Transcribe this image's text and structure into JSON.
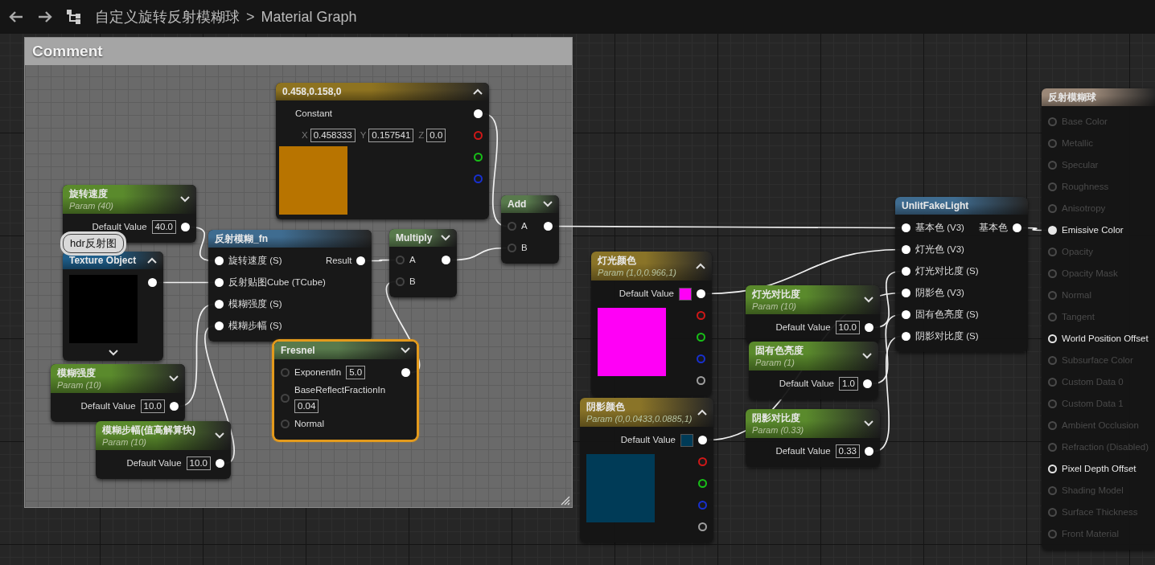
{
  "toolbar": {
    "breadcrumb": [
      {
        "label": "自定义旋转反射模糊球"
      },
      {
        "label": "Material Graph"
      }
    ],
    "separator": ">"
  },
  "comment": {
    "title": "Comment"
  },
  "tooltip": {
    "text": "hdr反射图"
  },
  "nodes": [
    {
      "kind": "constant",
      "title": "0.458,0.158,0",
      "expanded": true,
      "selected": false,
      "label": "Constant",
      "fields": [
        {
          "axis": "X",
          "value": "0.458333"
        },
        {
          "axis": "Y",
          "value": "0.157541"
        },
        {
          "axis": "Z",
          "value": "0.0"
        }
      ],
      "preview": {
        "color": "#b87400"
      },
      "pins": [
        {
          "color": "#ffffff",
          "filled": true
        },
        {
          "color": "#d01818",
          "filled": false
        },
        {
          "color": "#18c018",
          "filled": false
        },
        {
          "color": "#1830d0",
          "filled": false
        }
      ]
    },
    {
      "kind": "scalar_param",
      "title": "旋转速度",
      "subtitle": "Param (40)",
      "expanded": false,
      "selected": false,
      "outputs": [
        {
          "label": "Default Value",
          "value": "40.0",
          "filled": true
        }
      ]
    },
    {
      "kind": "texture",
      "title": "Texture Object",
      "expanded": true,
      "selected": false,
      "pins": [
        {
          "filled": true
        }
      ]
    },
    {
      "kind": "scalar_param",
      "title": "模糊强度",
      "subtitle": "Param (10)",
      "expanded": false,
      "selected": false,
      "outputs": [
        {
          "label": "Default Value",
          "value": "10.0",
          "filled": true
        }
      ]
    },
    {
      "kind": "scalar_param",
      "title": "模糊步幅(值高解算快)",
      "subtitle": "Param (10)",
      "expanded": false,
      "selected": false,
      "outputs": [
        {
          "label": "Default Value",
          "value": "10.0",
          "filled": true
        }
      ]
    },
    {
      "kind": "function",
      "title": "反射模糊_fn",
      "selected": false,
      "inputs": [
        {
          "label": "旋转速度 (S)",
          "filled": true
        },
        {
          "label": "反射贴图Cube (TCube)",
          "filled": true
        },
        {
          "label": "模糊强度 (S)",
          "filled": true
        },
        {
          "label": "模糊步幅 (S)",
          "filled": true
        }
      ],
      "outputs": [
        {
          "label": "Result",
          "filled": true
        }
      ]
    },
    {
      "kind": "math",
      "title": "Multiply",
      "expanded": false,
      "selected": false,
      "inputs": [
        {
          "label": "A",
          "filled": false,
          "color": "#444444"
        },
        {
          "label": "B",
          "filled": false,
          "color": "#444444"
        }
      ],
      "outputs": [
        {
          "filled": true
        }
      ]
    },
    {
      "kind": "math",
      "title": "Fresnel",
      "expanded": false,
      "selected": true,
      "inputs": [
        {
          "label": "ExponentIn",
          "value": "5.0",
          "filled": false,
          "color": "#444444"
        },
        {
          "label": "BaseReflectFractionIn",
          "value": "0.04",
          "filled": false,
          "color": "#444444"
        },
        {
          "label": "Normal",
          "filled": false,
          "color": "#444444"
        }
      ],
      "outputs": [
        {
          "filled": true
        }
      ]
    },
    {
      "kind": "math",
      "title": "Add",
      "expanded": false,
      "selected": false,
      "inputs": [
        {
          "label": "A",
          "filled": false,
          "color": "#444444"
        },
        {
          "label": "B",
          "filled": false,
          "color": "#444444"
        }
      ],
      "outputs": [
        {
          "filled": true
        }
      ]
    },
    {
      "kind": "vector_param",
      "title": "灯光颜色",
      "subtitle": "Param (1,0,0.966,1)",
      "expanded": true,
      "selected": false,
      "default_label": "Default Value",
      "swatch": {
        "color": "#ff00f6"
      },
      "preview": {
        "color": "#ff00f6"
      },
      "pins": [
        {
          "color": "#ffffff",
          "filled": true
        },
        {
          "color": "#d01818",
          "filled": false
        },
        {
          "color": "#18c018",
          "filled": false
        },
        {
          "color": "#1830d0",
          "filled": false
        },
        {
          "color": "#a0a0a0",
          "filled": false
        }
      ]
    },
    {
      "kind": "vector_param",
      "title": "阴影颜色",
      "subtitle": "Param (0,0.0433,0.0885,1)",
      "expanded": true,
      "selected": false,
      "default_label": "Default Value",
      "swatch": {
        "color": "#003b57"
      },
      "preview": {
        "color": "#003b57"
      },
      "pins": [
        {
          "color": "#ffffff",
          "filled": true
        },
        {
          "color": "#d01818",
          "filled": false
        },
        {
          "color": "#18c018",
          "filled": false
        },
        {
          "color": "#1830d0",
          "filled": false
        },
        {
          "color": "#a0a0a0",
          "filled": false
        }
      ]
    },
    {
      "kind": "scalar_param",
      "title": "灯光对比度",
      "subtitle": "Param (10)",
      "expanded": false,
      "selected": false,
      "outputs": [
        {
          "label": "Default Value",
          "value": "10.0",
          "filled": true
        }
      ]
    },
    {
      "kind": "scalar_param",
      "title": "固有色亮度",
      "subtitle": "Param (1)",
      "expanded": false,
      "selected": false,
      "outputs": [
        {
          "label": "Default Value",
          "value": "1.0",
          "filled": true
        }
      ]
    },
    {
      "kind": "scalar_param",
      "title": "阴影对比度",
      "subtitle": "Param (0.33)",
      "expanded": false,
      "selected": false,
      "outputs": [
        {
          "label": "Default Value",
          "value": "0.33",
          "filled": true
        }
      ]
    },
    {
      "kind": "function",
      "title": "UnlitFakeLight",
      "selected": false,
      "inputs": [
        {
          "label": "基本色 (V3)",
          "filled": true
        },
        {
          "label": "灯光色 (V3)",
          "filled": true
        },
        {
          "label": "灯光对比度 (S)",
          "filled": true
        },
        {
          "label": "阴影色 (V3)",
          "filled": true
        },
        {
          "label": "固有色亮度 (S)",
          "filled": true
        },
        {
          "label": "阴影对比度 (S)",
          "filled": true
        }
      ],
      "outputs": [
        {
          "label": "基本色",
          "filled": true
        }
      ]
    },
    {
      "kind": "result",
      "title": "反射模糊球",
      "selected": false,
      "pins": [
        {
          "label": "Base Color",
          "enabled": false,
          "filled": false
        },
        {
          "label": "Metallic",
          "enabled": false,
          "filled": false
        },
        {
          "label": "Specular",
          "enabled": false,
          "filled": false
        },
        {
          "label": "Roughness",
          "enabled": false,
          "filled": false
        },
        {
          "label": "Anisotropy",
          "enabled": false,
          "filled": false
        },
        {
          "label": "Emissive Color",
          "enabled": true,
          "filled": true
        },
        {
          "label": "Opacity",
          "enabled": false,
          "filled": false
        },
        {
          "label": "Opacity Mask",
          "enabled": false,
          "filled": false
        },
        {
          "label": "Normal",
          "enabled": false,
          "filled": false
        },
        {
          "label": "Tangent",
          "enabled": false,
          "filled": false
        },
        {
          "label": "World Position Offset",
          "enabled": true,
          "filled": false
        },
        {
          "label": "Subsurface Color",
          "enabled": false,
          "filled": false
        },
        {
          "label": "Custom Data 0",
          "enabled": false,
          "filled": false
        },
        {
          "label": "Custom Data 1",
          "enabled": false,
          "filled": false
        },
        {
          "label": "Ambient Occlusion",
          "enabled": false,
          "filled": false
        },
        {
          "label": "Refraction (Disabled)",
          "enabled": false,
          "filled": false
        },
        {
          "label": "Pixel Depth Offset",
          "enabled": true,
          "filled": false
        },
        {
          "label": "Shading Model",
          "enabled": false,
          "filled": false
        },
        {
          "label": "Surface Thickness",
          "enabled": false,
          "filled": false
        },
        {
          "label": "Front Material",
          "enabled": false,
          "filled": false
        }
      ]
    }
  ]
}
